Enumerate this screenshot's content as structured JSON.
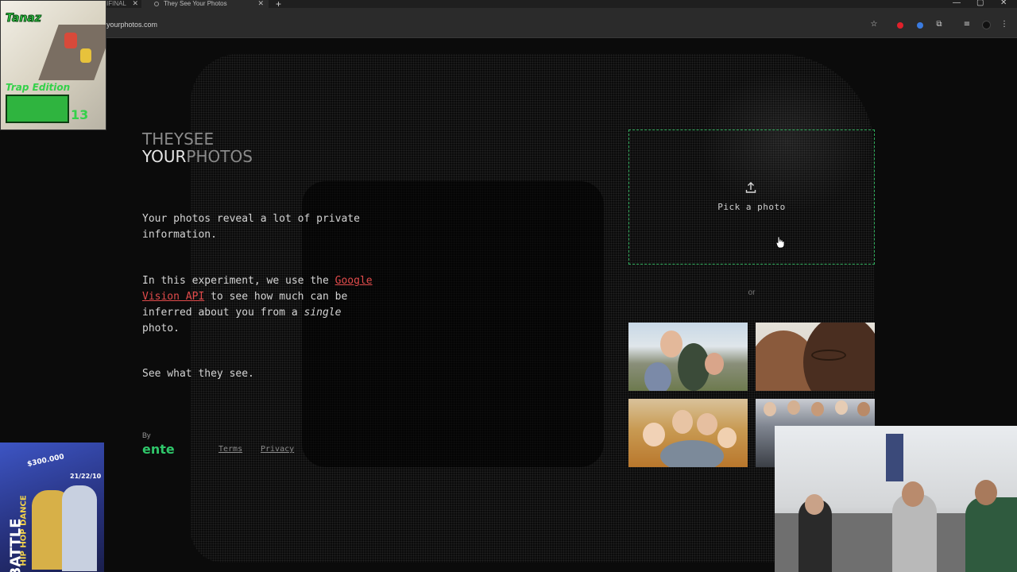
{
  "browser": {
    "tabs": [
      {
        "title": "IFINAL",
        "active": false
      },
      {
        "title": "They See Your Photos",
        "active": true
      }
    ],
    "url": "theyseeyourphotos.com",
    "url_visible": "yourphotos.com",
    "icons": [
      "close-icon",
      "new-tab-icon",
      "minimize-icon",
      "restore-icon",
      "close-window-icon",
      "bookmark-star-icon",
      "extensions-icon",
      "media-icon",
      "profile-icon",
      "menu-icon"
    ]
  },
  "page": {
    "logo": {
      "line1_dim": "THEY",
      "line1_bright": "SEE",
      "line2_bright": "YOUR",
      "line2_dim": "PHOTOS"
    },
    "intro": "Your photos reveal a lot of private information.",
    "experiment_prefix": "In this experiment, we use the",
    "vision_link": "Google Vision API",
    "experiment_suffix": "to see how much can be inferred about you from a",
    "single": "single",
    "photo_word": "photo.",
    "see": "See what they see.",
    "by": "By",
    "brand": "ente",
    "terms": "Terms",
    "privacy": "Privacy",
    "pick_label": "Pick a photo",
    "or_label": "or"
  },
  "colors": {
    "accent_green": "#2fc66a",
    "link_red": "#e14b4b",
    "background": "#0b0b0b"
  },
  "overlays": {
    "poster_top_text": [
      "Tanaz",
      "Trap Edition",
      "13"
    ],
    "poster_bottom_text": [
      "BATTLE",
      "HIP HOP DANCE",
      "$300.000",
      "21/22/10"
    ]
  }
}
